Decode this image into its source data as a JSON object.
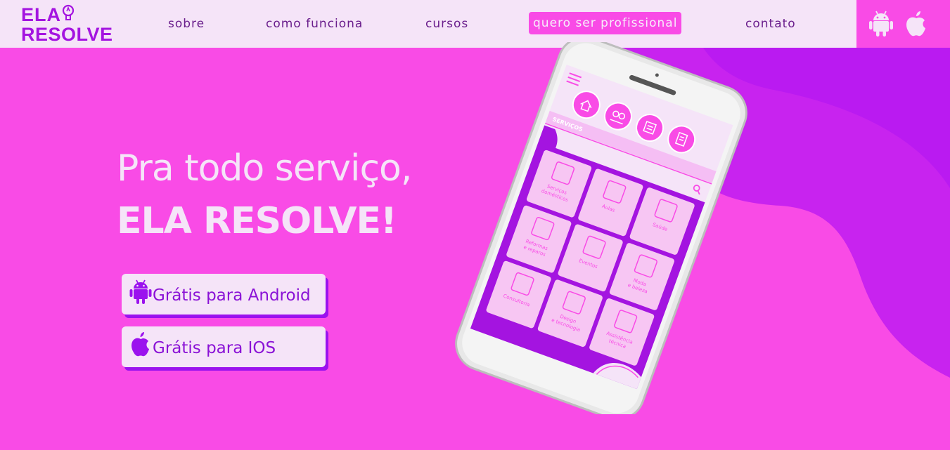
{
  "logo": {
    "line1": "ELA",
    "line2": "RESOLVE"
  },
  "nav": {
    "sobre": "sobre",
    "como_funciona": "como funciona",
    "cursos": "cursos",
    "quero": "quero ser profissional",
    "contato": "contato"
  },
  "hero": {
    "line1": "Pra todo serviço,",
    "line2": "ELA RESOLVE!",
    "cta_android": "Grátis para Android",
    "cta_ios": "Grátis para IOS"
  },
  "phone_screen": {
    "section_label": "SERVIÇOS",
    "tiles": [
      [
        "Serviços",
        "domésticos"
      ],
      [
        "Aulas"
      ],
      [
        "Saúde"
      ],
      [
        "Reformas",
        "e reparos"
      ],
      [
        "Eventos"
      ],
      [
        "Moda",
        "e beleza"
      ],
      [
        "Consultoria"
      ],
      [
        "Design",
        "e tecnologia"
      ],
      [
        "Assistência",
        "técnica"
      ]
    ]
  },
  "icons": {
    "android": "android-icon",
    "apple": "apple-icon",
    "bulb": "lightbulb-icon",
    "menu": "hamburger-menu-icon",
    "search": "search-icon"
  },
  "colors": {
    "background": "#f94be6",
    "header": "#f5e4f8",
    "brand_purple": "#a414e0",
    "accent_purple": "#9b12ee",
    "nav_text": "#6a1e8c"
  }
}
